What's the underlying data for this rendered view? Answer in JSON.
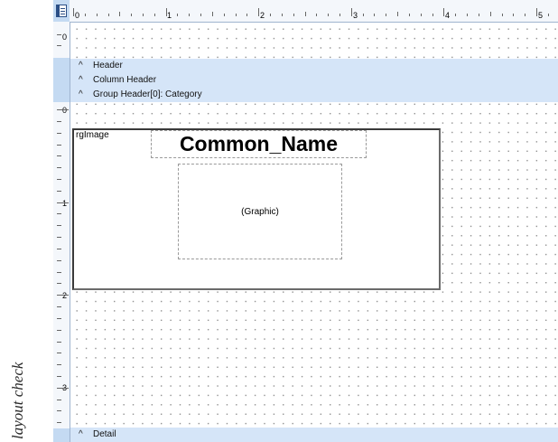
{
  "side_caption": "layout check",
  "ruler": {
    "h_numbers": [
      "0",
      "1",
      "2",
      "3",
      "4",
      "5"
    ],
    "v_numbers_top": [
      "0"
    ],
    "v_numbers_detail": [
      "0",
      "1",
      "2",
      "3"
    ]
  },
  "bands": {
    "header": "Header",
    "column_header": "Column Header",
    "group_header": "Group Header[0]: Category",
    "detail": "Detail"
  },
  "detail": {
    "image_field": "rgImage",
    "name_field": "Common_Name",
    "graphic_placeholder": "(Graphic)"
  },
  "colors": {
    "band_bg": "#d5e5f8",
    "ruler_band": "#c4daf2",
    "grid_dot": "#8a8a8a"
  },
  "icons": {
    "corner": "report-layout-icon",
    "band_toggle": "caret-up-icon"
  }
}
